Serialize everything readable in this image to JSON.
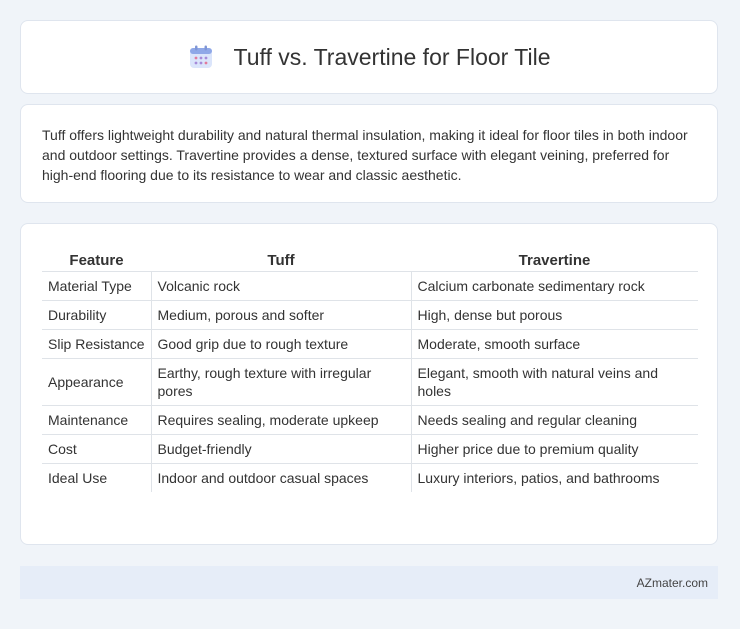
{
  "header": {
    "title": "Tuff vs. Travertine for Floor Tile",
    "icon": "calendar-icon"
  },
  "intro": {
    "text": "Tuff offers lightweight durability and natural thermal insulation, making it ideal for floor tiles in both indoor and outdoor settings. Travertine provides a dense, textured surface with elegant veining, preferred for high-end flooring due to its resistance to wear and classic aesthetic."
  },
  "table": {
    "headers": [
      "Feature",
      "Tuff",
      "Travertine"
    ],
    "rows": [
      [
        "Material Type",
        "Volcanic rock",
        "Calcium carbonate sedimentary rock"
      ],
      [
        "Durability",
        "Medium, porous and softer",
        "High, dense but porous"
      ],
      [
        "Slip Resistance",
        "Good grip due to rough texture",
        "Moderate, smooth surface"
      ],
      [
        "Appearance",
        "Earthy, rough texture with irregular pores",
        "Elegant, smooth with natural veins and holes"
      ],
      [
        "Maintenance",
        "Requires sealing, moderate upkeep",
        "Needs sealing and regular cleaning"
      ],
      [
        "Cost",
        "Budget-friendly",
        "Higher price due to premium quality"
      ],
      [
        "Ideal Use",
        "Indoor and outdoor casual spaces",
        "Luxury interiors, patios, and bathrooms"
      ]
    ]
  },
  "footer": {
    "brand": "AZmater.com"
  },
  "colors": {
    "background": "#f0f4f9",
    "card": "#ffffff",
    "footer": "#e6edf8",
    "icon_accent": "#8fa8e8"
  }
}
